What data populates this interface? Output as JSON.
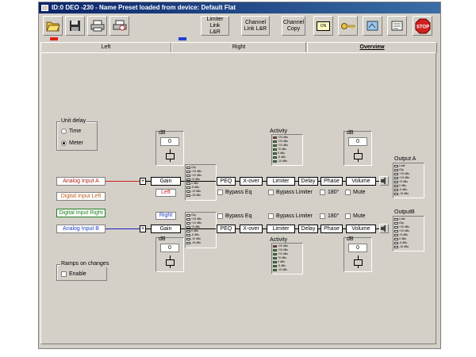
{
  "window": {
    "title": "ID:0 DEO -230 - Name Preset loaded from device: Default Flat"
  },
  "toolbar": {
    "open_icon": "folder-open-icon",
    "save_icon": "floppy-disk-icon",
    "print_icon": "printer-icon",
    "print_preview_icon": "print-preview-icon",
    "limiter_link_label": "Limiter Link\nL&R",
    "channel_link_label": "Channel\nLink L&R",
    "channel_copy_label": "Channel\nCopy",
    "status_icon": "device-status-icon",
    "key_icon": "key-icon",
    "settings_icon": "settings-icon",
    "notes_icon": "notes-icon",
    "stop_label": "STOP"
  },
  "tabs": [
    {
      "label": "Left"
    },
    {
      "label": "Right"
    },
    {
      "label": "Overview"
    }
  ],
  "colors": {
    "left_marker": "#e02010",
    "right_marker": "#2040d0",
    "left_signal": "#d02020",
    "right_signal": "#2020c0"
  },
  "unit_delay": {
    "title": "Unit delay",
    "options": [
      "Time",
      "Meter"
    ],
    "selected": "Meter"
  },
  "ramps": {
    "title": "Ramps on changes",
    "enable_label": "Enable",
    "enabled": false
  },
  "inputs": {
    "analog_a": "Analog Input A",
    "digital_left": "Digital Input Left",
    "digital_right": "Digital Input Right",
    "analog_b": "Analog Input B"
  },
  "channel_a": {
    "gain_db_label": "dB",
    "gain_value": "0",
    "volume_db_label": "dB",
    "volume_value": "0",
    "plus_symbol": "+",
    "gain_label": "Gain",
    "channel_name": "Left",
    "peq_label": "PEQ",
    "xover_label": "X-over",
    "limiter_label": "Limiter",
    "delay_label": "Delay",
    "phase_label": "Phase",
    "volume_label": "Volume",
    "bypass_eq_label": "Bypass Eq",
    "bypass_limiter_label": "Bypass Limiter",
    "phase180_label": "180°",
    "mute_label": "Mute",
    "activity_title": "Activity",
    "output_title": "Output A",
    "speaker_icon": "speaker-icon"
  },
  "channel_b": {
    "gain_db_label": "dB",
    "gain_value": "0",
    "volume_db_label": "dB",
    "volume_value": "0",
    "plus_symbol": "+",
    "gain_label": "Gain",
    "channel_name": "Right",
    "peq_label": "PEQ",
    "xover_label": "X-over",
    "limiter_label": "Limiter",
    "delay_label": "Delay",
    "phase_label": "Phase",
    "volume_label": "Volume",
    "bypass_eq_label": "Bypass Eq",
    "bypass_limiter_label": "Bypass Limiter",
    "phase180_label": "180°",
    "mute_label": "Mute",
    "activity_title": "Activity",
    "output_title": "OutputB",
    "speaker_icon": "speaker-icon"
  },
  "meters": {
    "input_scale": [
      "Clip",
      "+15 dBu",
      "+10 dBu",
      "+5 dBu",
      "0 dBu",
      "-5 dBu",
      "-10 dBu",
      "-15 dBu"
    ],
    "activity_scale": [
      "+20 dBu",
      "+15 dBu",
      "+10 dBu",
      "+5 dBu",
      "0 dBu",
      "-5 dBu",
      "-10 dBu"
    ],
    "output_scale": [
      "Limit",
      "Clip",
      "+15 dBu",
      "+10 dBu",
      "+5 dBu",
      "0 dBu",
      "-5 dBu",
      "-15 dBu"
    ]
  }
}
